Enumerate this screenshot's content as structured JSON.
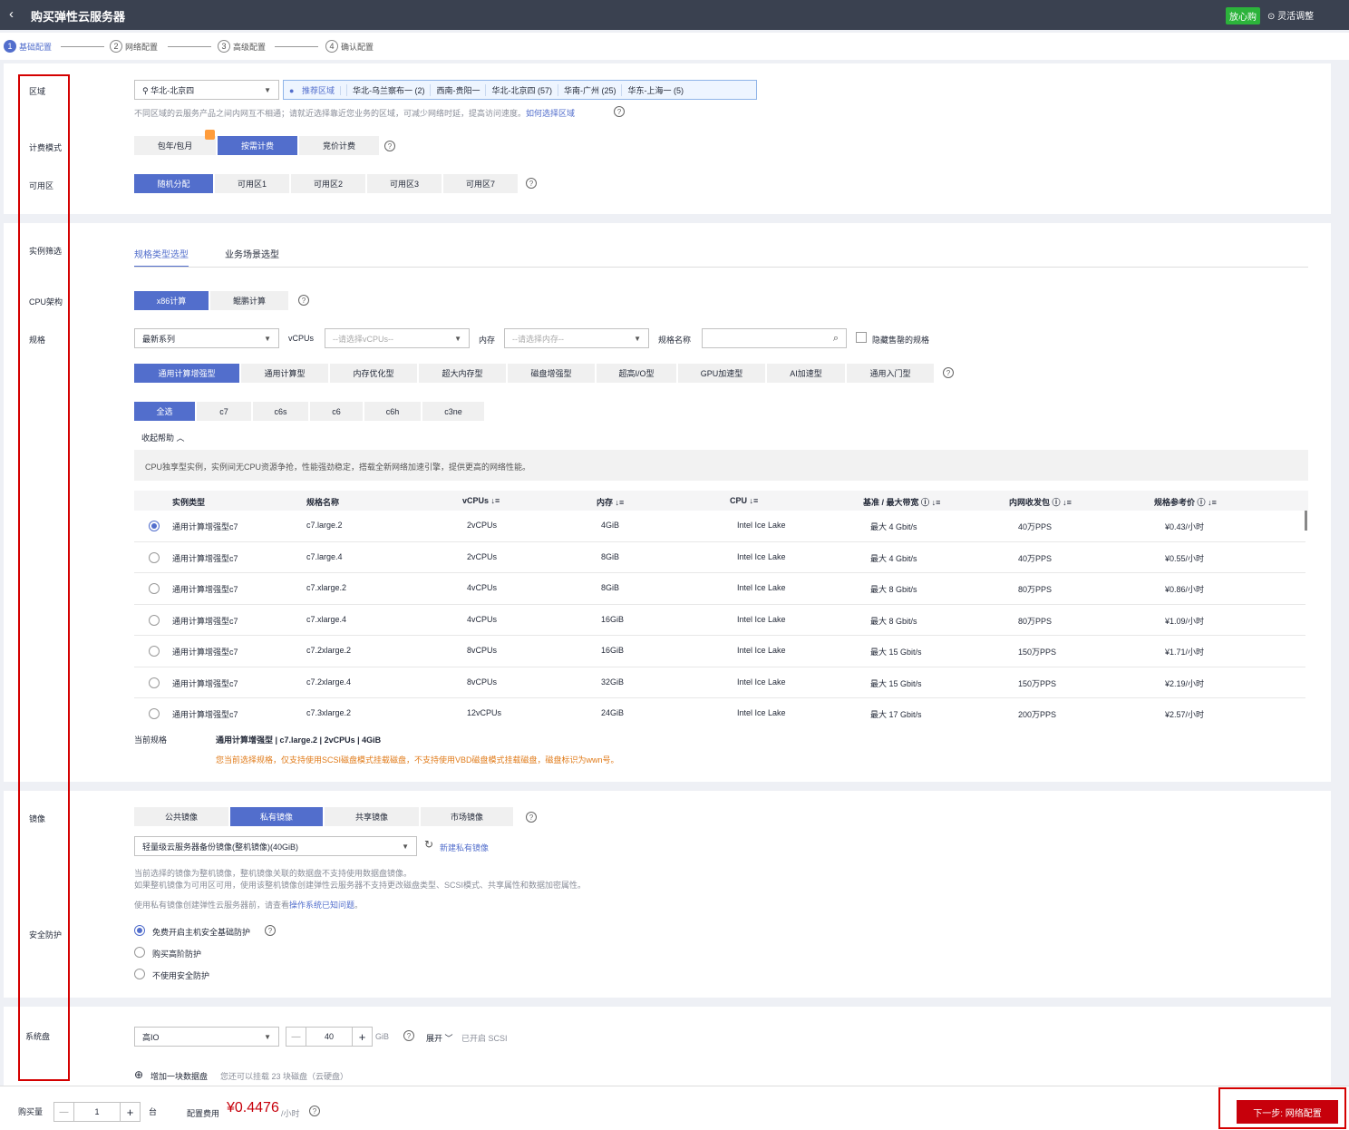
{
  "topbar": {
    "back_icon": "chevron-left-icon",
    "title": "购买弹性云服务器",
    "badge": "放心购",
    "flex": "灵活调整"
  },
  "steps": [
    {
      "num": "1",
      "label": "基础配置"
    },
    {
      "num": "2",
      "label": "网络配置"
    },
    {
      "num": "3",
      "label": "高级配置"
    },
    {
      "num": "4",
      "label": "确认配置"
    }
  ],
  "region": {
    "label": "区域",
    "selected": "华北-北京四",
    "recommend_label": "推荐区域",
    "recommend": [
      "华北-乌兰察布一 (2)",
      "西南-贵阳一",
      "华北-北京四 (57)",
      "华南-广州 (25)",
      "华东-上海一 (5)"
    ],
    "hint": "不同区域的云服务产品之间内网互不相通；请就近选择靠近您业务的区域，可减少网络时延，提高访问速度。",
    "hint_link": "如何选择区域"
  },
  "billing": {
    "label": "计费模式",
    "options": [
      "包年/包月",
      "按需计费",
      "竞价计费"
    ],
    "selected": "按需计费"
  },
  "az": {
    "label": "可用区",
    "options": [
      "随机分配",
      "可用区1",
      "可用区2",
      "可用区3",
      "可用区7"
    ],
    "selected": "随机分配"
  },
  "instance": {
    "label": "实例筛选",
    "tabs": [
      "规格类型选型",
      "业务场景选型"
    ],
    "cpu_label": "CPU架构",
    "cpu_options": [
      "x86计算",
      "鲲鹏计算"
    ],
    "spec_label": "规格",
    "series": "最新系列",
    "vcpus_label": "vCPUs",
    "vcpus_placeholder": "--请选择vCPUs--",
    "mem_label": "内存",
    "mem_placeholder": "--请选择内存--",
    "name_label": "规格名称",
    "hide_soldout": "隐藏售罄的规格",
    "types": [
      "通用计算增强型",
      "通用计算型",
      "内存优化型",
      "超大内存型",
      "磁盘增强型",
      "超高I/O型",
      "GPU加速型",
      "AI加速型",
      "通用入门型"
    ],
    "families": [
      "全选",
      "c7",
      "c6s",
      "c6",
      "c6h",
      "c3ne"
    ],
    "collapse": "收起帮助",
    "desc": "CPU独享型实例，实例间无CPU资源争抢，性能强劲稳定，搭载全新网络加速引擎，提供更高的网络性能。",
    "columns": [
      "实例类型",
      "规格名称",
      "vCPUs",
      "内存",
      "CPU",
      "基准 / 最大带宽",
      "内网收发包",
      "规格参考价"
    ],
    "rows": [
      [
        "通用计算增强型c7",
        "c7.large.2",
        "2vCPUs",
        "4GiB",
        "Intel Ice Lake",
        "最大 4 Gbit/s",
        "40万PPS",
        "¥0.43/小时"
      ],
      [
        "通用计算增强型c7",
        "c7.large.4",
        "2vCPUs",
        "8GiB",
        "Intel Ice Lake",
        "最大 4 Gbit/s",
        "40万PPS",
        "¥0.55/小时"
      ],
      [
        "通用计算增强型c7",
        "c7.xlarge.2",
        "4vCPUs",
        "8GiB",
        "Intel Ice Lake",
        "最大 8 Gbit/s",
        "80万PPS",
        "¥0.86/小时"
      ],
      [
        "通用计算增强型c7",
        "c7.xlarge.4",
        "4vCPUs",
        "16GiB",
        "Intel Ice Lake",
        "最大 8 Gbit/s",
        "80万PPS",
        "¥1.09/小时"
      ],
      [
        "通用计算增强型c7",
        "c7.2xlarge.2",
        "8vCPUs",
        "16GiB",
        "Intel Ice Lake",
        "最大 15 Gbit/s",
        "150万PPS",
        "¥1.71/小时"
      ],
      [
        "通用计算增强型c7",
        "c7.2xlarge.4",
        "8vCPUs",
        "32GiB",
        "Intel Ice Lake",
        "最大 15 Gbit/s",
        "150万PPS",
        "¥2.19/小时"
      ],
      [
        "通用计算增强型c7",
        "c7.3xlarge.2",
        "12vCPUs",
        "24GiB",
        "Intel Ice Lake",
        "最大 17 Gbit/s",
        "200万PPS",
        "¥2.57/小时"
      ]
    ],
    "current_label": "当前规格",
    "current_value": "通用计算增强型 | c7.large.2 | 2vCPUs | 4GiB",
    "current_warn": "您当前选择规格，仅支持使用SCSI磁盘模式挂载磁盘，不支持使用VBD磁盘模式挂载磁盘，磁盘标识为wwn号。"
  },
  "image": {
    "label": "镜像",
    "tabs": [
      "公共镜像",
      "私有镜像",
      "共享镜像",
      "市场镜像"
    ],
    "selected_tab": "私有镜像",
    "selected": "轻量级云服务器备份镜像(整机镜像)(40GiB)",
    "new_link": "新建私有镜像",
    "hint1": "当前选择的镜像为整机镜像，整机镜像关联的数据盘不支持使用数据盘镜像。",
    "hint2": "如果整机镜像为可用区可用，使用该整机镜像创建弹性云服务器不支持更改磁盘类型、SCSI模式、共享属性和数据加密属性。",
    "hint3_pre": "使用私有镜像创建弹性云服务器前，请查看",
    "hint3_link": "操作系统已知问题",
    "hint3_post": "。"
  },
  "security": {
    "label": "安全防护",
    "options": [
      "免费开启主机安全基础防护",
      "购买高阶防护",
      "不使用安全防护"
    ]
  },
  "disk": {
    "label": "系统盘",
    "type": "高IO",
    "size": "40",
    "unit": "GiB",
    "expand": "展开",
    "scsi": "已开启 SCSI",
    "add": "增加一块数据盘",
    "add_hint": "您还可以挂载 23 块磁盘（云硬盘）"
  },
  "footer": {
    "qty_label": "购买量",
    "qty": "1",
    "qty_unit": "台",
    "fee_label": "配置费用",
    "fee": "¥0.4476",
    "fee_unit": "/小时",
    "next": "下一步: 网络配置"
  },
  "colors": {
    "accent": "#526ecc",
    "danger": "#c7000b",
    "highlight": "#d40000"
  }
}
